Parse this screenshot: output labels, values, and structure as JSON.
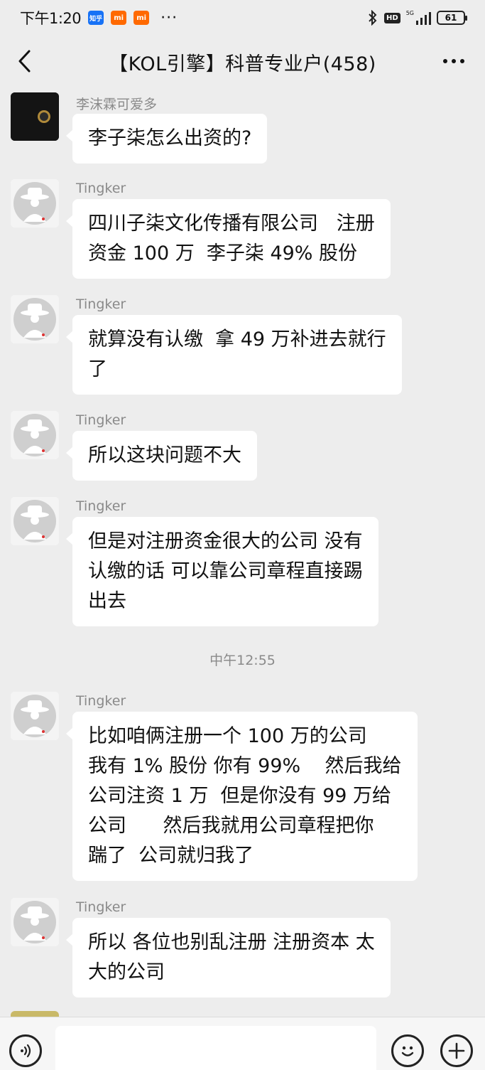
{
  "status_bar": {
    "time": "下午1:20",
    "app_badges": [
      {
        "label": "知乎",
        "color": "#1772f6"
      },
      {
        "label": "mi",
        "color": "#ff6900"
      },
      {
        "label": "mi",
        "color": "#ff6900"
      }
    ],
    "more": "···",
    "hd": "HD",
    "network": "5G",
    "battery": "61"
  },
  "nav": {
    "title": "【KOL引擎】科普专业户(458)"
  },
  "messages": [
    {
      "sender": "李沫霖可爱多",
      "text": "李子柒怎么出资的?"
    },
    {
      "sender": "Tingker",
      "text": "四川子柒文化传播有限公司   注册\n资金 100 万  李子柒 49% 股份"
    },
    {
      "sender": "Tingker",
      "text": "就算没有认缴  拿 49 万补进去就行\n了"
    },
    {
      "sender": "Tingker",
      "text": "所以这块问题不大"
    },
    {
      "sender": "Tingker",
      "text": "但是对注册资金很大的公司 没有\n认缴的话 可以靠公司章程直接踢\n出去"
    },
    {
      "sender": "Tingker",
      "text": "比如咱俩注册一个 100 万的公司\n我有 1% 股份 你有 99%    然后我给\n公司注资 1 万  但是你没有 99 万给\n公司      然后我就用公司章程把你\n踹了  公司就归我了"
    },
    {
      "sender": "Tingker",
      "text": "所以 各位也别乱注册 注册资本 太\n大的公司"
    }
  ],
  "time_separator": "中午12:55",
  "input": {
    "value": "",
    "placeholder": ""
  },
  "colors": {
    "background": "#ededed",
    "bubble": "#ffffff",
    "meta_text": "#8a8a8a"
  }
}
